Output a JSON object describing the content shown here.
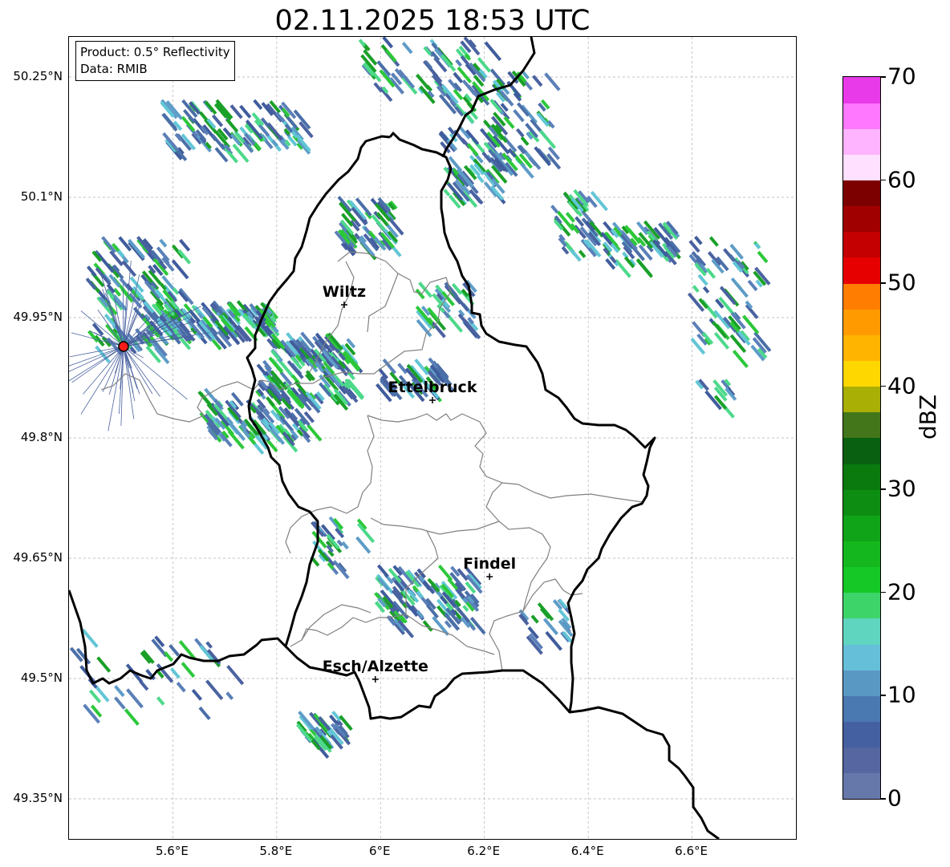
{
  "title": "02.11.2025 18:53 UTC",
  "info_box": {
    "product": "Product: 0.5° Reflectivity",
    "data": "Data: RMIB"
  },
  "map": {
    "lon_range": [
      5.4,
      6.8
    ],
    "lat_range": [
      49.3,
      50.3
    ],
    "latitude_ticks": [
      {
        "value": 50.25,
        "label": "50.25°N"
      },
      {
        "value": 50.1,
        "label": "50.1°N"
      },
      {
        "value": 49.95,
        "label": "49.95°N"
      },
      {
        "value": 49.8,
        "label": "49.8°N"
      },
      {
        "value": 49.65,
        "label": "49.65°N"
      },
      {
        "value": 49.5,
        "label": "49.5°N"
      },
      {
        "value": 49.35,
        "label": "49.35°N"
      }
    ],
    "longitude_ticks": [
      {
        "value": 5.6,
        "label": "5.6°E"
      },
      {
        "value": 5.8,
        "label": "5.8°E"
      },
      {
        "value": 6.0,
        "label": "6°E"
      },
      {
        "value": 6.2,
        "label": "6.2°E"
      },
      {
        "value": 6.4,
        "label": "6.4°E"
      },
      {
        "value": 6.6,
        "label": "6.6°E"
      }
    ],
    "grid": true,
    "radar_site": {
      "lon": 5.505,
      "lat": 49.914,
      "color": "#ff1a1a"
    },
    "cities": [
      {
        "name": "Wiltz",
        "lon": 5.93,
        "lat": 49.966
      },
      {
        "name": "Ettelbruck",
        "lon": 6.1,
        "lat": 49.847
      },
      {
        "name": "Findel",
        "lon": 6.21,
        "lat": 49.627
      },
      {
        "name": "Esch/Alzette",
        "lon": 5.99,
        "lat": 49.499
      }
    ],
    "border_color": "#000000",
    "canton_border_color": "#808080"
  },
  "colorbar": {
    "label": "dBZ",
    "min": 0,
    "max": 70,
    "ticks": [
      0,
      10,
      20,
      30,
      40,
      50,
      60,
      70
    ],
    "colors": [
      "#6677aa",
      "#5566a0",
      "#4560a0",
      "#4a78b0",
      "#5a98c4",
      "#66bfd8",
      "#5fd5c0",
      "#3dd46a",
      "#15c825",
      "#14b81e",
      "#10a518",
      "#0d8e12",
      "#0a7a0e",
      "#086010",
      "#43761a",
      "#aaaf05",
      "#ffd700",
      "#ffb400",
      "#ff9b00",
      "#ff7d00",
      "#e60000",
      "#c40000",
      "#a00000",
      "#7d0000",
      "#ffe0ff",
      "#ffb4ff",
      "#ff78ff",
      "#e83ae8"
    ]
  }
}
